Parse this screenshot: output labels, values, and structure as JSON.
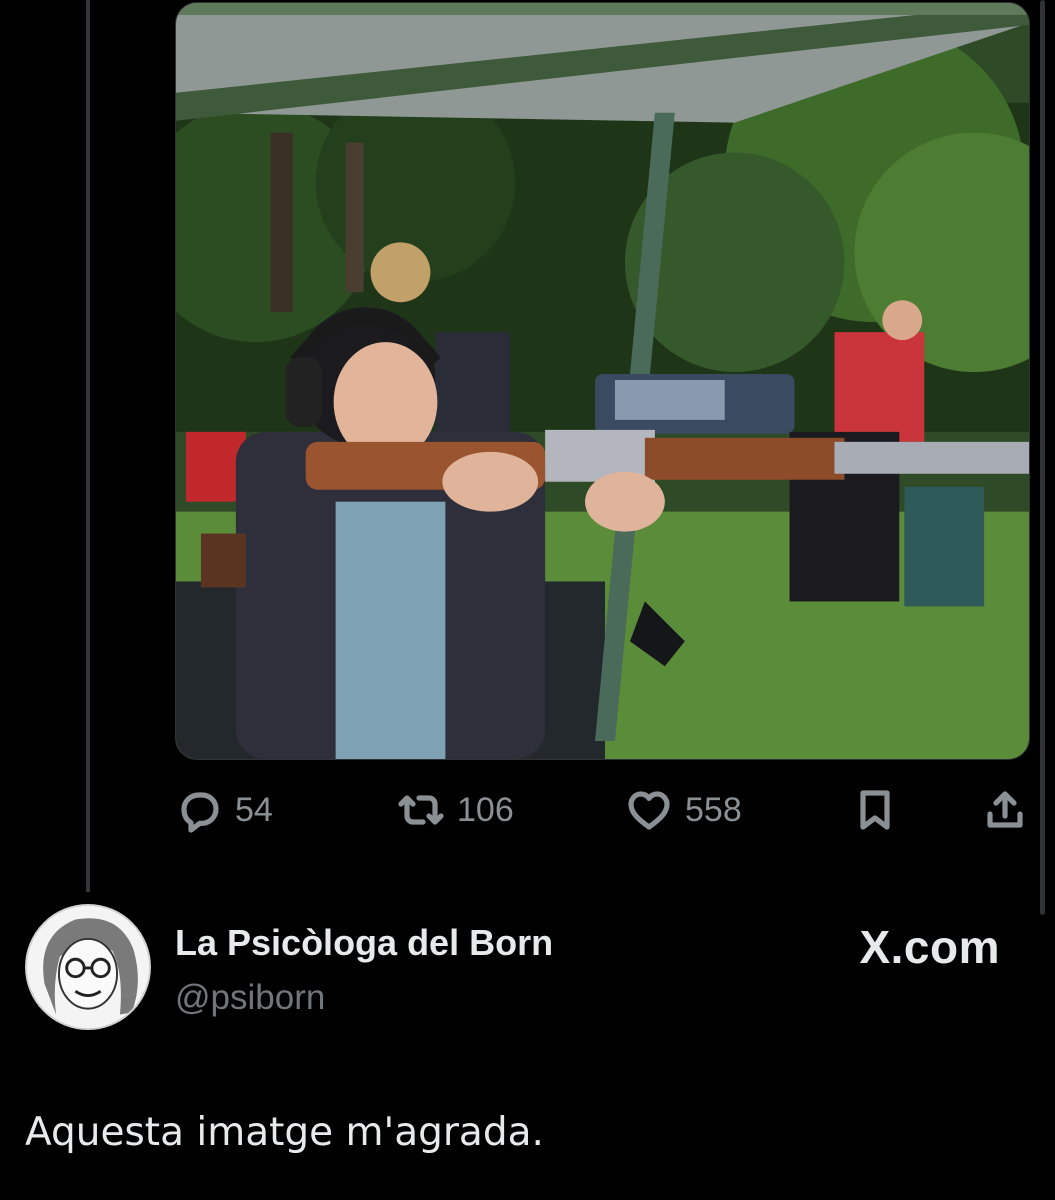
{
  "tweet": {
    "photo_alt": "photo",
    "actions": {
      "replies": "54",
      "retweets": "106",
      "likes": "558"
    },
    "icons": {
      "reply": "reply-icon",
      "retweet": "retweet-icon",
      "like": "heart-icon",
      "bookmark": "bookmark-icon",
      "share": "share-icon"
    }
  },
  "author": {
    "display_name": "La Psicòloga del Born",
    "handle": "@psiborn",
    "avatar_icon": "avatar"
  },
  "branding": {
    "site": "X.com"
  },
  "post": {
    "text": "Aquesta imatge m'agrada."
  },
  "colors": {
    "background": "#000000",
    "primary_text": "#e7e9ea",
    "secondary_text": "#71767b",
    "divider": "#2f3336"
  }
}
